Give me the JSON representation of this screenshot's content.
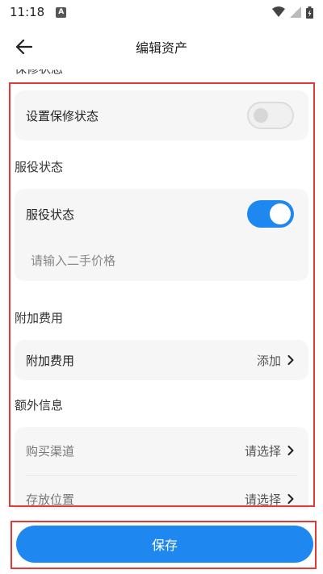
{
  "status_bar": {
    "time": "11:18",
    "notification_letter": "A"
  },
  "app_bar": {
    "title": "编辑资产"
  },
  "form": {
    "partial_section_title": "保修状态",
    "warranty": {
      "label": "设置保修状态",
      "enabled": false
    },
    "service_section_title": "服役状态",
    "service": {
      "label": "服役状态",
      "enabled": true,
      "price_placeholder": "请输入二手价格"
    },
    "extra_fee_section_title": "附加费用",
    "extra_fee": {
      "label": "附加费用",
      "action": "添加"
    },
    "extra_info_section_title": "额外信息",
    "extra_info": [
      {
        "label": "购买渠道",
        "value": "请选择"
      },
      {
        "label": "存放位置",
        "value": "请选择"
      }
    ]
  },
  "save_button": {
    "label": "保存"
  },
  "colors": {
    "accent": "#1e88f0",
    "highlight": "#e53935",
    "card_bg": "#f6f6f6"
  }
}
